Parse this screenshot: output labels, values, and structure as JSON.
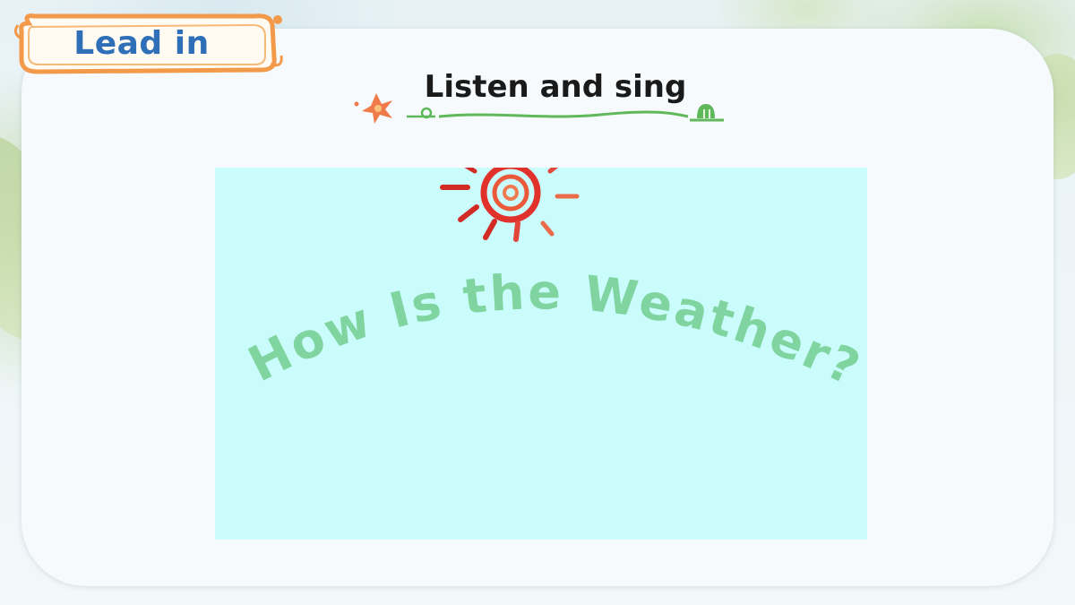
{
  "header": {
    "badge_label": "Lead in",
    "section_title": "Listen and sing"
  },
  "media": {
    "song_title": "How Is the Weather?"
  },
  "colors": {
    "badge_text": "#2f6fb8",
    "badge_border": "#f29a4a",
    "media_background": "#cbfcfc",
    "song_title_text": "#7fd4a0",
    "sun_red": "#e0312a",
    "underline_green": "#5fb85a"
  },
  "icons": [
    "sun-icon",
    "flower-icon",
    "snail-icon",
    "sprout-icon"
  ]
}
